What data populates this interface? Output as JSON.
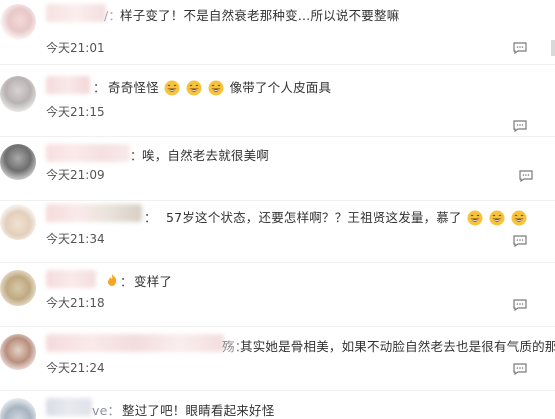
{
  "comments": [
    {
      "name_suffix": "/：",
      "text": "样子变了！不是自然衰老那种变…所以说不要整嘛",
      "time": "今天21:01"
    },
    {
      "name_suffix": "：",
      "text_before": "奇奇怪怪",
      "text_after": "像带了个人皮面具",
      "time": "今天21:15"
    },
    {
      "name_suffix": "：",
      "text": "唉，自然老去就很美啊",
      "time": "今天21:09"
    },
    {
      "name_suffix": "：",
      "text": "57岁这个状态，还要怎样啊？？王祖贤这发量，慕了",
      "time": "今天21:34"
    },
    {
      "name_suffix": "：",
      "text": "变样了",
      "time": "今大21:18"
    },
    {
      "name_suffix": "殇：",
      "text": "其实她是骨相美，如果不动脸自然老去也是很有气质的那种",
      "time": "今天21:24"
    },
    {
      "name_suffix": "ve：",
      "text": "整过了吧！眼睛看起来好怪",
      "time": ""
    }
  ],
  "icons": {
    "reply": "reply-icon",
    "laugh": "grinning-face-emoji"
  }
}
